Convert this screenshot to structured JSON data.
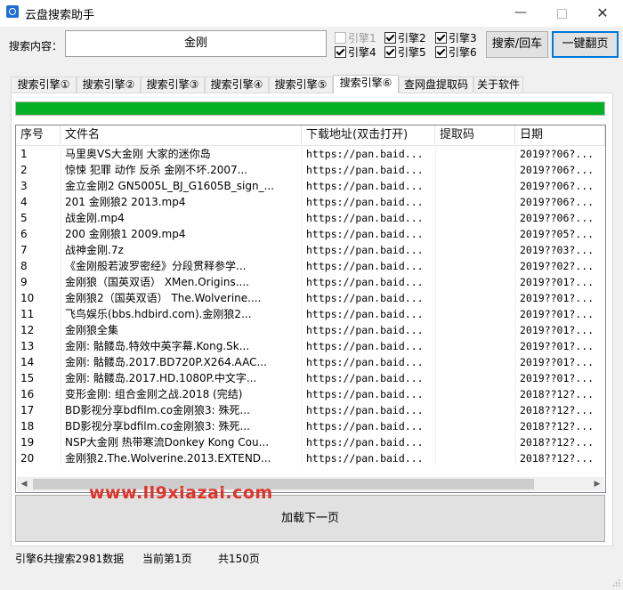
{
  "window": {
    "title": "云盘搜索助手"
  },
  "search": {
    "label": "搜索内容：",
    "value": "金刚"
  },
  "engines": [
    {
      "label": "引擎1",
      "checked": false,
      "disabled": true
    },
    {
      "label": "引擎2",
      "checked": true,
      "disabled": false
    },
    {
      "label": "引擎3",
      "checked": true,
      "disabled": false
    },
    {
      "label": "引擎4",
      "checked": true,
      "disabled": false
    },
    {
      "label": "引擎5",
      "checked": true,
      "disabled": false
    },
    {
      "label": "引擎6",
      "checked": true,
      "disabled": false
    }
  ],
  "buttons": {
    "search": "搜索/回车",
    "flip": "一键翻页",
    "load_next": "加载下一页"
  },
  "tabs": [
    "搜索引擎①",
    "搜索引擎②",
    "搜索引擎③",
    "搜索引擎④",
    "搜索引擎⑤",
    "搜索引擎⑥",
    "查网盘提取码",
    "关于软件"
  ],
  "active_tab": 5,
  "progress": {
    "percent": 100,
    "color": "#06b025"
  },
  "table": {
    "headers": [
      "序号",
      "文件名",
      "下载地址(双击打开)",
      "提取码",
      "日期"
    ],
    "rows": [
      [
        "1",
        "马里奥VS大金刚 大家的迷你岛",
        "https://pan.baid...",
        "",
        "2019??06?..."
      ],
      [
        "2",
        "惊悚 犯罪 动作 反杀 金刚不坏.2007...",
        "https://pan.baid...",
        "",
        "2019??06?..."
      ],
      [
        "3",
        "金立金刚2 GN5005L_BJ_G1605B_sign_...",
        "https://pan.baid...",
        "",
        "2019??06?..."
      ],
      [
        "4",
        "201 金刚狼2   2013.mp4",
        "https://pan.baid...",
        "",
        "2019??06?..."
      ],
      [
        "5",
        "战金刚.mp4",
        "https://pan.baid...",
        "",
        "2019??06?..."
      ],
      [
        "6",
        "200 金刚狼1   2009.mp4",
        "https://pan.baid...",
        "",
        "2019??05?..."
      ],
      [
        "7",
        "战神金刚.7z",
        "https://pan.baid...",
        "",
        "2019??03?..."
      ],
      [
        "8",
        "《金刚般若波罗密经》分段贯释参学...",
        "https://pan.baid...",
        "",
        "2019??02?..."
      ],
      [
        "9",
        "金刚狼（国英双语）  XMen.Origins....",
        "https://pan.baid...",
        "",
        "2019??01?..."
      ],
      [
        "10",
        "金刚狼2（国英双语） The.Wolverine....",
        "https://pan.baid...",
        "",
        "2019??01?..."
      ],
      [
        "11",
        "飞鸟娱乐(bbs.hdbird.com).金刚狼2...",
        "https://pan.baid...",
        "",
        "2019??01?..."
      ],
      [
        "12",
        "金刚狼全集",
        "https://pan.baid...",
        "",
        "2019??01?..."
      ],
      [
        "13",
        "金刚: 骷髅岛.特效中英字幕.Kong.Sk...",
        "https://pan.baid...",
        "",
        "2019??01?..."
      ],
      [
        "14",
        "金刚: 骷髅岛.2017.BD720P.X264.AAC...",
        "https://pan.baid...",
        "",
        "2019??01?..."
      ],
      [
        "15",
        "金刚: 骷髅岛.2017.HD.1080P.中文字...",
        "https://pan.baid...",
        "",
        "2019??01?..."
      ],
      [
        "16",
        "变形金刚: 组合金刚之战.2018 (完结)",
        "https://pan.baid...",
        "",
        "2018??12?..."
      ],
      [
        "17",
        "BD影视分享bdfilm.co金刚狼3: 殊死...",
        "https://pan.baid...",
        "",
        "2018??12?..."
      ],
      [
        "18",
        "BD影视分享bdfilm.co金刚狼3: 殊死...",
        "https://pan.baid...",
        "",
        "2018??12?..."
      ],
      [
        "19",
        "NSP大金刚 热带寒流Donkey Kong Cou...",
        "https://pan.baid...",
        "",
        "2018??12?..."
      ],
      [
        "20",
        "金刚狼2.The.Wolverine.2013.EXTEND...",
        "https://pan.baid...",
        "",
        "2018??12?..."
      ]
    ]
  },
  "watermark": "www.ll9xiazai.com",
  "status": {
    "total": "引擎6共搜索2981数据",
    "current": "当前第1页",
    "pages": "共150页"
  }
}
